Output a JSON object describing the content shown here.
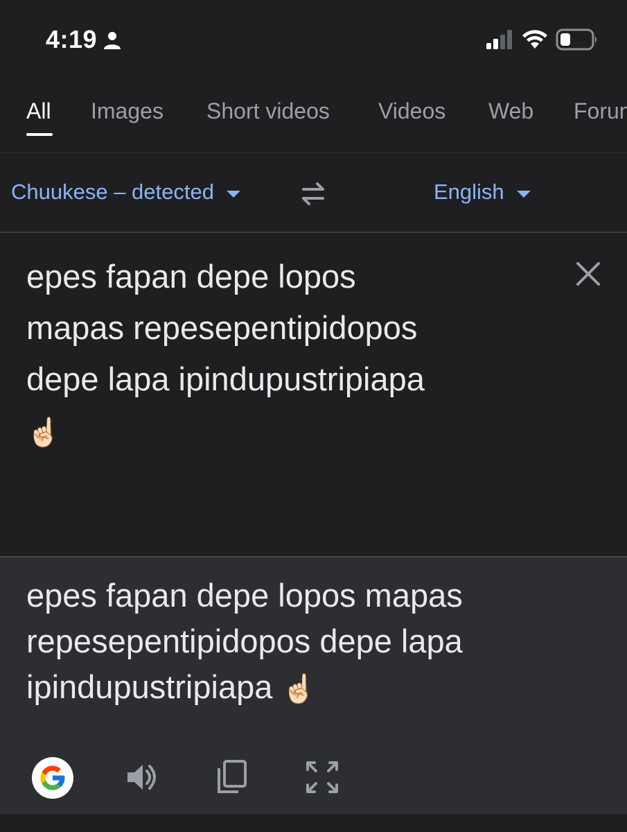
{
  "status_bar": {
    "time": "4:19",
    "icons": [
      "person-icon",
      "signal-icon",
      "wifi-icon",
      "battery-icon"
    ]
  },
  "tabs": [
    {
      "label": "All",
      "active": true
    },
    {
      "label": "Images",
      "active": false
    },
    {
      "label": "Short videos",
      "active": false
    },
    {
      "label": "Videos",
      "active": false
    },
    {
      "label": "Web",
      "active": false
    },
    {
      "label": "Forums",
      "active": false
    }
  ],
  "language_bar": {
    "source_language": "Chuukese – detected",
    "target_language": "English",
    "swap_icon": "swap-arrows-icon"
  },
  "source": {
    "lines": [
      "epes fapan depe lopos",
      "mapas repesepentipidopos",
      "depe lapa ipindupustripiapa"
    ],
    "emoji": "☝🏻",
    "clear_icon": "close-icon"
  },
  "result": {
    "lines": [
      "epes fapan depe lopos mapas",
      "repesepentipidopos depe lapa",
      "ipindupustripiapa"
    ],
    "emoji": "☝🏻",
    "actions": [
      "google-logo-icon",
      "speaker-icon",
      "copy-icon",
      "fullscreen-icon"
    ]
  },
  "colors": {
    "background": "#1f1f21",
    "result_background": "#2d2e32",
    "link_blue": "#8ab4f8",
    "muted_text": "#9aa0a6"
  }
}
